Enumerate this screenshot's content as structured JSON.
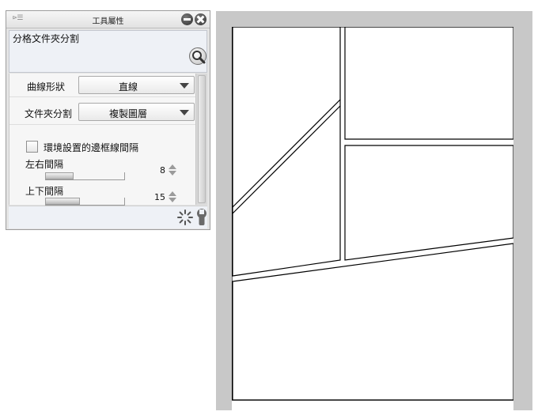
{
  "window": {
    "title": "工具屬性",
    "grip_icon": "panel-menu-icon",
    "minimize_icon": "minimize-icon",
    "close_icon": "close-icon"
  },
  "tool": {
    "name": "分格文件夾分割",
    "search_icon": "magnify-icon"
  },
  "properties": {
    "curve_shape": {
      "label": "曲線形狀",
      "value": "直線"
    },
    "folder_split": {
      "label": "文件夾分割",
      "value": "複製圖層"
    },
    "use_env_setting": {
      "label": "環境設置的邊框線間隔",
      "checked": false
    },
    "horizontal_gap": {
      "label": "左右間隔",
      "value": "8",
      "fraction": 0.36
    },
    "vertical_gap": {
      "label": "上下間隔",
      "value": "15",
      "fraction": 0.44
    }
  },
  "footer": {
    "reset_icon": "reset-icon",
    "settings_icon": "wrench-icon"
  },
  "canvas": {
    "panel_border_color": "#000000",
    "background_color": "#c8c8c8",
    "paper_color": "#ffffff"
  }
}
